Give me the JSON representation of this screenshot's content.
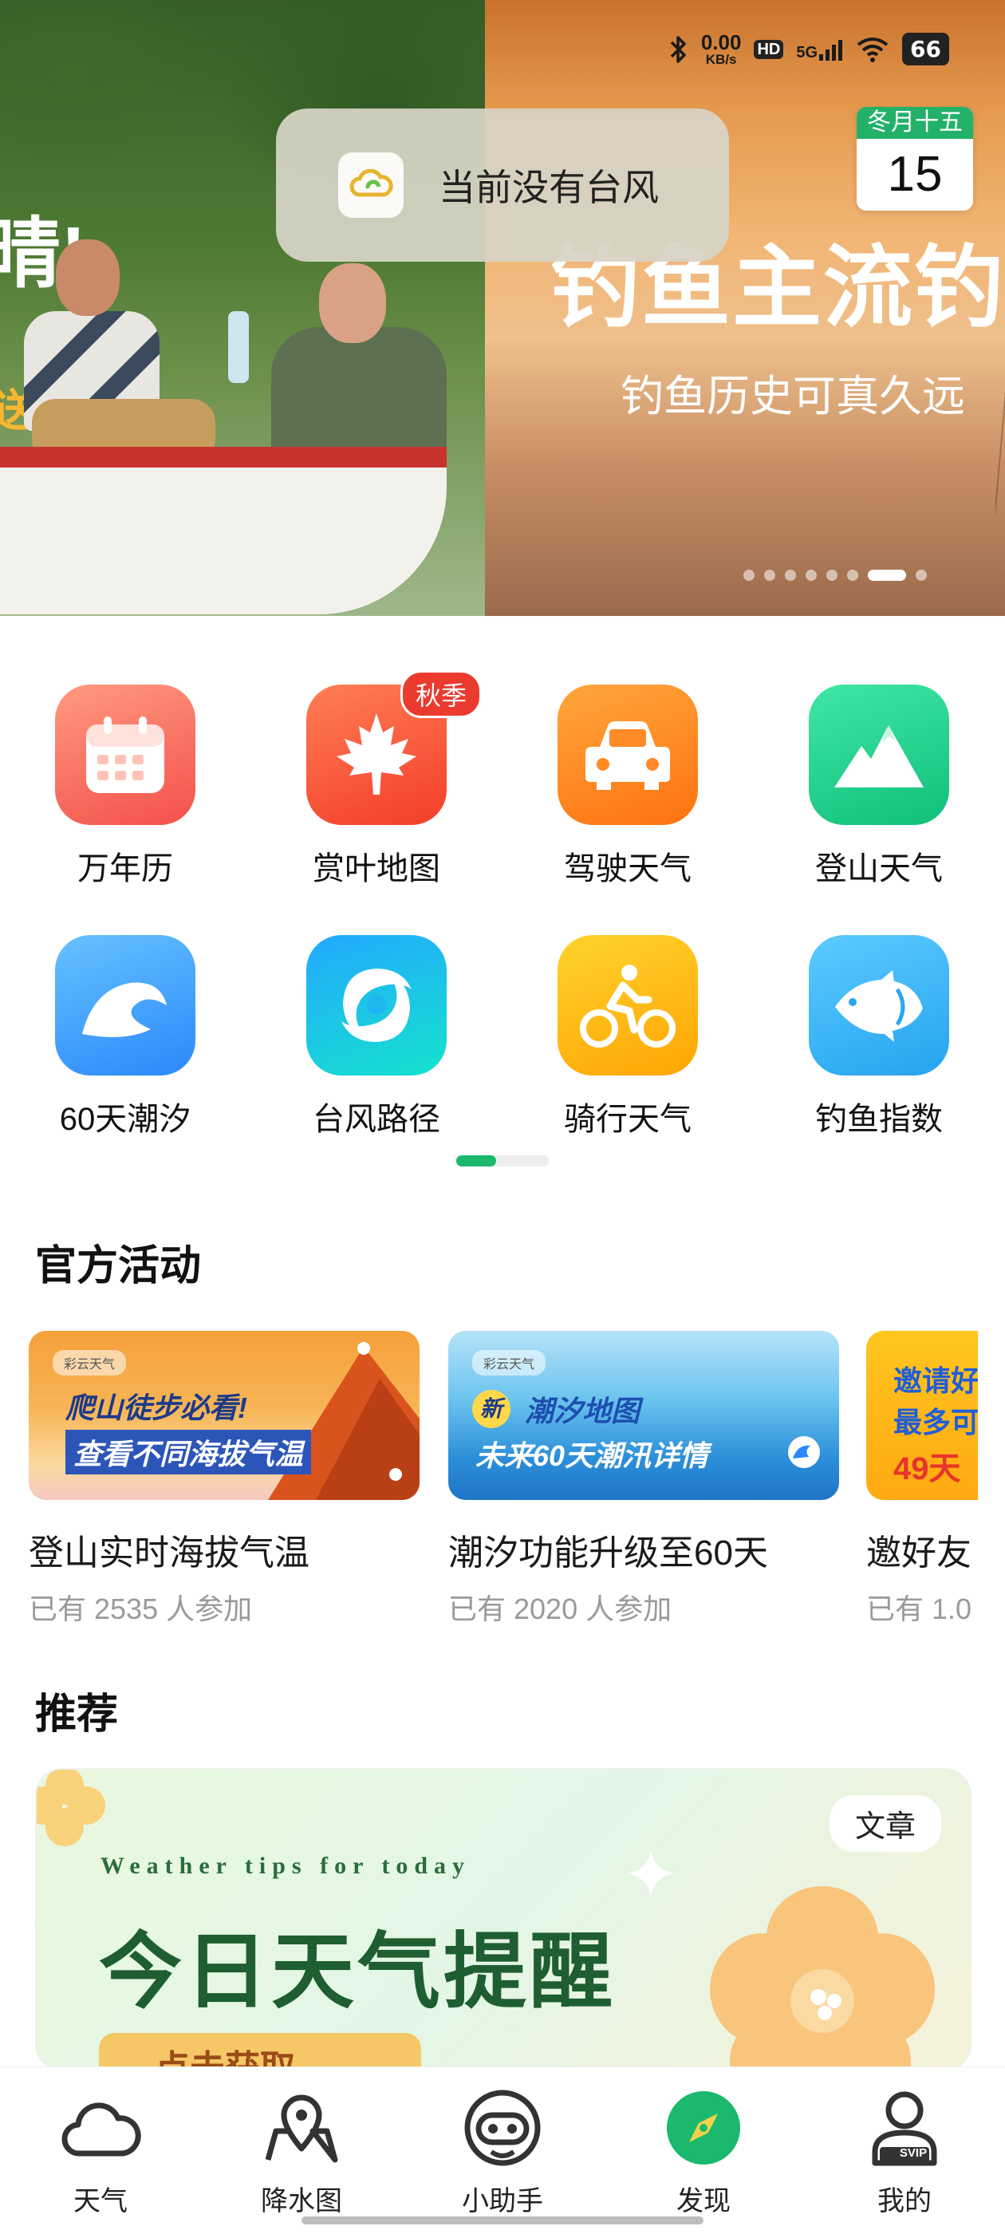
{
  "status_bar": {
    "net_speed_value": "0.00",
    "net_speed_unit": "KB/s",
    "hd": "HD",
    "signal": "5G",
    "battery": "66"
  },
  "hero": {
    "left_text": "晴!",
    "left_text2": "送",
    "title": "钓鱼主流钓",
    "subtitle": "钓鱼历史可真久远",
    "slide_count": 8,
    "active_slide": 7
  },
  "calendar": {
    "month_label": "冬月十五",
    "day": "15"
  },
  "toast": {
    "text": "当前没有台风",
    "icon": "cloud-logo-icon"
  },
  "tools": [
    {
      "label": "万年历",
      "icon": "calendar-icon",
      "color_top": "#ff8f7a",
      "color_bottom": "#f4564a"
    },
    {
      "label": "赏叶地图",
      "icon": "maple-leaf-icon",
      "badge": "秋季",
      "color_top": "#ff7a52",
      "color_bottom": "#f23c2a"
    },
    {
      "label": "驾驶天气",
      "icon": "car-icon",
      "color_top": "#ffa23a",
      "color_bottom": "#ff7410"
    },
    {
      "label": "登山天气",
      "icon": "mountain-icon",
      "color_top": "#3fe3a3",
      "color_bottom": "#12c17a"
    },
    {
      "label": "60天潮汐",
      "icon": "wave-icon",
      "color_top": "#5bb9ff",
      "color_bottom": "#2e8dfb"
    },
    {
      "label": "台风路径",
      "icon": "typhoon-icon",
      "color_top": "#2fb0ff",
      "color_bottom": "#16e0d0"
    },
    {
      "label": "骑行天气",
      "icon": "bike-icon",
      "color_top": "#ffd026",
      "color_bottom": "#ffa807"
    },
    {
      "label": "钓鱼指数",
      "icon": "fish-icon",
      "color_top": "#59c9ff",
      "color_bottom": "#2aa6f0"
    }
  ],
  "activities": {
    "title": "官方活动",
    "items": [
      {
        "title": "登山实时海拔气温",
        "participants": "已有 2535 人参加",
        "banner_line1": "爬山徒步必看!",
        "banner_line2": "查看不同海拔气温",
        "logo": "彩云天气"
      },
      {
        "title": "潮汐功能升级至60天",
        "participants": "已有 2020 人参加",
        "banner_tag": "新",
        "banner_line1": "潮汐地图",
        "banner_line2": "未来60天潮汛详情",
        "logo": "彩云天气"
      },
      {
        "title": "邀好友",
        "participants": "已有 1.0",
        "banner_line1": "邀请好",
        "banner_line2": "最多可",
        "banner_line3": "49天"
      }
    ]
  },
  "recommend": {
    "title": "推荐",
    "tag": "文章",
    "en_text": "Weather tips for today",
    "cn_title": "今日天气提醒",
    "button": "点击获取"
  },
  "bottom_nav": [
    {
      "label": "天气",
      "icon": "cloud-icon"
    },
    {
      "label": "降水图",
      "icon": "map-pin-icon"
    },
    {
      "label": "小助手",
      "icon": "assistant-icon"
    },
    {
      "label": "发现",
      "icon": "compass-icon",
      "active": true
    },
    {
      "label": "我的",
      "icon": "profile-svip-icon",
      "badge": "SVIP"
    }
  ],
  "colors": {
    "accent": "#1ab96e",
    "badge_red": "#ea3b2e"
  }
}
